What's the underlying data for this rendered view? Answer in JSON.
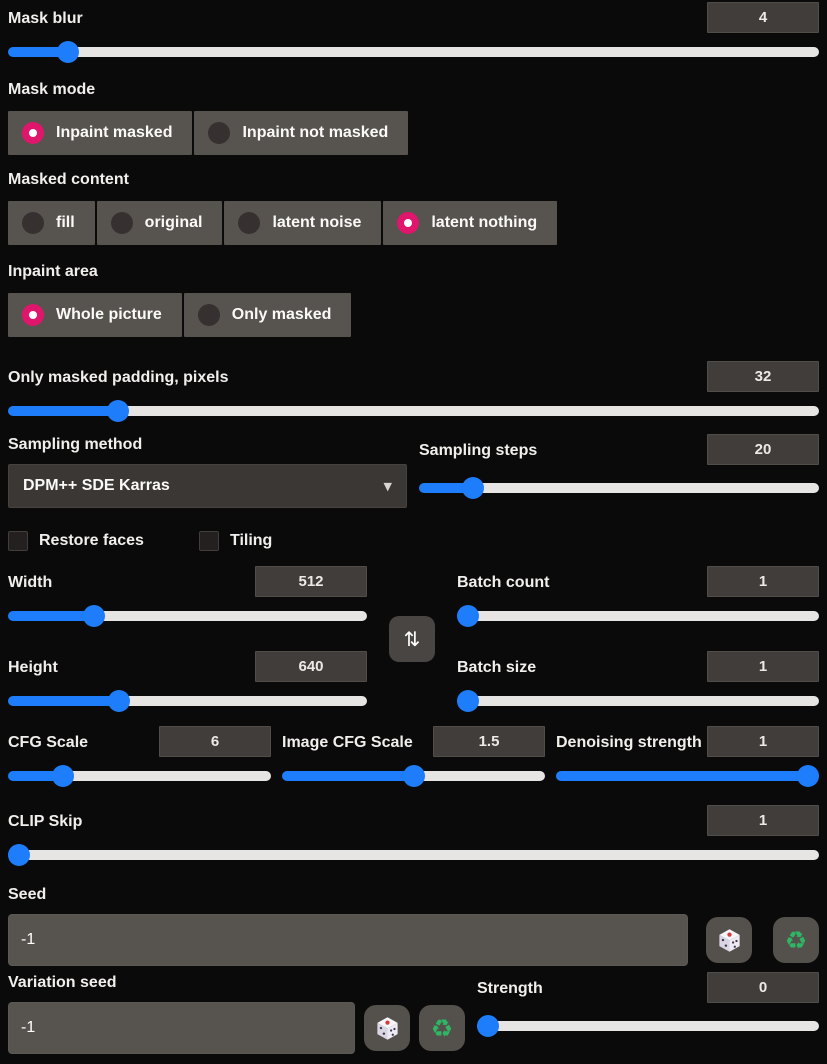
{
  "theme": {
    "background": "#0b0a0a",
    "accent_blue": "#1d7dfb",
    "accent_pink": "#e0166d",
    "panel_gray": "#57534e",
    "track_gray": "#e7e5e3",
    "recycle_green": "#2fb564"
  },
  "fields": {
    "mask_blur": {
      "label": "Mask blur",
      "value": "4",
      "fill_pct": "7.4%"
    },
    "mask_mode": {
      "label": "Mask mode",
      "options": [
        {
          "label": "Inpaint masked",
          "selected": true
        },
        {
          "label": "Inpaint not masked",
          "selected": false
        }
      ]
    },
    "masked_content": {
      "label": "Masked content",
      "options": [
        {
          "label": "fill",
          "selected": false
        },
        {
          "label": "original",
          "selected": false
        },
        {
          "label": "latent noise",
          "selected": false
        },
        {
          "label": "latent nothing",
          "selected": true
        }
      ]
    },
    "inpaint_area": {
      "label": "Inpaint area",
      "options": [
        {
          "label": "Whole picture",
          "selected": true
        },
        {
          "label": "Only masked",
          "selected": false
        }
      ]
    },
    "masked_padding": {
      "label": "Only masked padding, pixels",
      "value": "32",
      "fill_pct": "13.6%"
    },
    "sampling_method": {
      "label": "Sampling method",
      "value": "DPM++ SDE Karras"
    },
    "sampling_steps": {
      "label": "Sampling steps",
      "value": "20",
      "fill_pct": "13.5%"
    },
    "restore_faces": {
      "label": "Restore faces",
      "checked": false
    },
    "tiling": {
      "label": "Tiling",
      "checked": false
    },
    "width": {
      "label": "Width",
      "value": "512",
      "fill_pct": "24%"
    },
    "height": {
      "label": "Height",
      "value": "640",
      "fill_pct": "31%"
    },
    "batch_count": {
      "label": "Batch count",
      "value": "1",
      "fill_pct": "1.5%"
    },
    "batch_size": {
      "label": "Batch size",
      "value": "1",
      "fill_pct": "1.5%"
    },
    "cfg_scale": {
      "label": "CFG Scale",
      "value": "6",
      "fill_pct": "21%"
    },
    "image_cfg_scale": {
      "label": "Image CFG Scale",
      "value": "1.5",
      "fill_pct": "50%"
    },
    "denoising_strength": {
      "label": "Denoising strength",
      "value": "1",
      "fill_pct": "100%"
    },
    "clip_skip": {
      "label": "CLIP Skip",
      "value": "1",
      "fill_pct": "1.2%"
    },
    "seed": {
      "label": "Seed",
      "value": "-1"
    },
    "variation_seed": {
      "label": "Variation seed",
      "value": "-1"
    },
    "variation_strength": {
      "label": "Strength",
      "value": "0",
      "fill_pct": "1.5%"
    }
  },
  "icons": {
    "swap": "⇅",
    "caret": "▼",
    "recycle": "♻"
  }
}
